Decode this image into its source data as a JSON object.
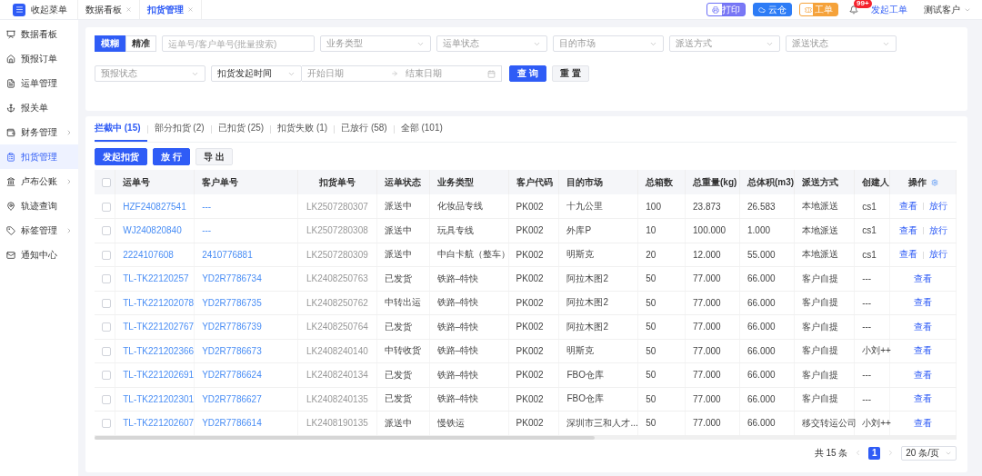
{
  "header": {
    "menu_toggle": "收起菜单",
    "page_tabs": [
      {
        "label": "数据看板",
        "selected": false
      },
      {
        "label": "扣货管理",
        "selected": true
      }
    ],
    "actions": [
      {
        "kind": "print",
        "label": "打印"
      },
      {
        "kind": "cloud",
        "label": "云仓"
      },
      {
        "kind": "ticket",
        "label": "工单"
      }
    ],
    "notification_badge": "99+",
    "create_ticket_link": "发起工单",
    "user": "测试客户"
  },
  "sidebar": {
    "items": [
      {
        "label": "数据看板",
        "selected": false,
        "expandable": false
      },
      {
        "label": "预报订单",
        "selected": false,
        "expandable": false
      },
      {
        "label": "运单管理",
        "selected": false,
        "expandable": false
      },
      {
        "label": "报关单",
        "selected": false,
        "expandable": false
      },
      {
        "label": "财务管理",
        "selected": false,
        "expandable": true
      },
      {
        "label": "扣货管理",
        "selected": true,
        "expandable": false
      },
      {
        "label": "卢布公账",
        "selected": false,
        "expandable": true
      },
      {
        "label": "轨迹查询",
        "selected": false,
        "expandable": false
      },
      {
        "label": "标签管理",
        "selected": false,
        "expandable": true
      },
      {
        "label": "通知中心",
        "selected": false,
        "expandable": false
      }
    ]
  },
  "filters": {
    "mode": [
      {
        "label": "模糊",
        "selected": true
      },
      {
        "label": "精准",
        "selected": false
      }
    ],
    "search_placeholder": "运单号/客户单号(批量搜索)",
    "selects": [
      "业务类型",
      "运单状态",
      "目的市场",
      "派送方式",
      "派送状态"
    ],
    "forecast_select": "预报状态",
    "time_select": "扣货发起时间",
    "date_start": "开始日期",
    "date_end": "结束日期",
    "query_button": "查 询",
    "reset_button": "重 置"
  },
  "status_tabs": [
    {
      "label": "拦截中 (15)",
      "selected": true
    },
    {
      "label": "部分扣货 (2)",
      "selected": false
    },
    {
      "label": "已扣货 (25)",
      "selected": false
    },
    {
      "label": "扣货失败 (1)",
      "selected": false
    },
    {
      "label": "已放行 (58)",
      "selected": false
    },
    {
      "label": "全部 (101)",
      "selected": false
    }
  ],
  "toolbar": [
    {
      "label": "发起扣货",
      "kind": "primary"
    },
    {
      "label": "放 行",
      "kind": "primary"
    },
    {
      "label": "导 出",
      "kind": "default"
    }
  ],
  "table": {
    "all_checked": false,
    "columns": [
      "运单号",
      "客户单号",
      "扣货单号",
      "运单状态",
      "业务类型",
      "客户代码",
      "目的市场",
      "总箱数",
      "总重量(kg)",
      "总体积(m3)",
      "派送方式",
      "创建人",
      "操作"
    ],
    "rows": [
      {
        "checked": false,
        "cells": [
          "HZF240827541",
          "---",
          "LK2507280307",
          "派送中",
          "化妆品专线",
          "PK002",
          "十九公里",
          "100",
          "23.873",
          "26.583",
          "本地派送",
          "cs1"
        ],
        "actions": [
          "查看",
          "放行"
        ]
      },
      {
        "checked": false,
        "cells": [
          "WJ240820840",
          "---",
          "LK2507280308",
          "派送中",
          "玩具专线",
          "PK002",
          "外库P",
          "10",
          "100.000",
          "1.000",
          "本地派送",
          "cs1"
        ],
        "actions": [
          "查看",
          "放行"
        ]
      },
      {
        "checked": false,
        "cells": [
          "2224107608",
          "2410776881",
          "LK2507280309",
          "派送中",
          "中白卡航（整车）",
          "PK002",
          "明斯克",
          "20",
          "12.000",
          "55.000",
          "本地派送",
          "cs1"
        ],
        "actions": [
          "查看",
          "放行"
        ]
      },
      {
        "checked": false,
        "cells": [
          "TL-TK22120257",
          "YD2R7786734",
          "LK2408250763",
          "已发货",
          "铁路–特快",
          "PK002",
          "阿拉木图2",
          "50",
          "77.000",
          "66.000",
          "客户自提",
          "---"
        ],
        "actions": [
          "查看"
        ]
      },
      {
        "checked": false,
        "cells": [
          "TL-TK221202078",
          "YD2R7786735",
          "LK2408250762",
          "中转出运",
          "铁路–特快",
          "PK002",
          "阿拉木图2",
          "50",
          "77.000",
          "66.000",
          "客户自提",
          "---"
        ],
        "actions": [
          "查看"
        ]
      },
      {
        "checked": false,
        "cells": [
          "TL-TK221202767",
          "YD2R7786739",
          "LK2408250764",
          "已发货",
          "铁路–特快",
          "PK002",
          "阿拉木图2",
          "50",
          "77.000",
          "66.000",
          "客户自提",
          "---"
        ],
        "actions": [
          "查看"
        ]
      },
      {
        "checked": false,
        "cells": [
          "TL-TK221202366",
          "YD2R7786673",
          "LK2408240140",
          "中转收货",
          "铁路–特快",
          "PK002",
          "明斯克",
          "50",
          "77.000",
          "66.000",
          "客户自提",
          "小刘++"
        ],
        "actions": [
          "查看"
        ]
      },
      {
        "checked": false,
        "cells": [
          "TL-TK221202691",
          "YD2R7786624",
          "LK2408240134",
          "已发货",
          "铁路–特快",
          "PK002",
          "FBO仓库",
          "50",
          "77.000",
          "66.000",
          "客户自提",
          "---"
        ],
        "actions": [
          "查看"
        ]
      },
      {
        "checked": false,
        "cells": [
          "TL-TK221202301",
          "YD2R7786627",
          "LK2408240135",
          "已发货",
          "铁路–特快",
          "PK002",
          "FBO仓库",
          "50",
          "77.000",
          "66.000",
          "客户自提",
          "---"
        ],
        "actions": [
          "查看"
        ]
      },
      {
        "checked": false,
        "cells": [
          "TL-TK221202607",
          "YD2R7786614",
          "LK2408190135",
          "派送中",
          "慢铁运",
          "PK002",
          "深圳市三和人才...",
          "50",
          "77.000",
          "66.000",
          "移交转运公司",
          "小刘++"
        ],
        "actions": [
          "查看"
        ]
      }
    ]
  },
  "pagination": {
    "total": "共 15 条",
    "pages": [
      {
        "label": "1",
        "selected": true
      }
    ],
    "page_size": "20 条/页"
  }
}
